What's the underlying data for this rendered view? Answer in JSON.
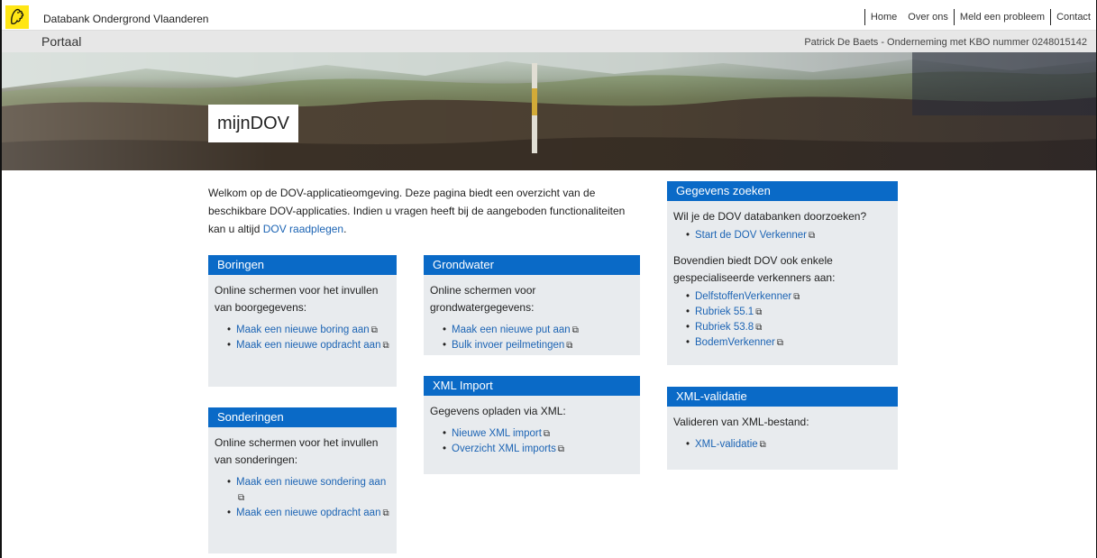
{
  "header": {
    "site_title": "Databank Ondergrond Vlaanderen",
    "nav": [
      "Home",
      "Over ons",
      "Meld een probleem",
      "Contact"
    ]
  },
  "subheader": {
    "portal": "Portaal",
    "user": "Patrick De Baets - Onderneming met KBO nummer 0248015142"
  },
  "banner": {
    "title": "mijnDOV"
  },
  "intro": {
    "text": "Welkom op de DOV-applicatieomgeving. Deze pagina biedt een overzicht van de beschikbare DOV-applicaties. Indien u vragen heeft bij de aangeboden functionaliteiten kan u altijd ",
    "link": "DOV raadplegen",
    "end": "."
  },
  "boringen": {
    "title": "Boringen",
    "text": "Online schermen voor het invullen van boorgegevens:",
    "links": [
      "Maak een nieuwe boring aan",
      "Maak een nieuwe opdracht aan"
    ]
  },
  "sonderingen": {
    "title": "Sonderingen",
    "text": "Online schermen voor het invullen van sonderingen:",
    "links": [
      "Maak een nieuwe sondering aan",
      "Maak een nieuwe opdracht aan"
    ]
  },
  "grondwater": {
    "title": "Grondwater",
    "text": "Online schermen voor grondwatergegevens:",
    "links": [
      "Maak een nieuwe put aan",
      "Bulk invoer peilmetingen"
    ]
  },
  "xml_import": {
    "title": "XML Import",
    "text": "Gegevens opladen via XML:",
    "links": [
      "Nieuwe XML import",
      "Overzicht XML imports"
    ]
  },
  "gegevens": {
    "title": "Gegevens zoeken",
    "text1": "Wil je de DOV databanken doorzoeken?",
    "links1": [
      "Start de DOV Verkenner"
    ],
    "text2": "Bovendien biedt DOV ook enkele gespecialiseerde verkenners aan:",
    "links2": [
      "DelfstoffenVerkenner",
      "Rubriek 55.1",
      "Rubriek 53.8",
      "BodemVerkenner"
    ]
  },
  "xml_validatie": {
    "title": "XML-validatie",
    "text": "Valideren van XML-bestand:",
    "links": [
      "XML-validatie"
    ]
  },
  "icons": {
    "logo": "flemish-lion-logo",
    "external": "external-link-icon",
    "ext_glyph": "⧉"
  },
  "colors": {
    "panel_header": "#0a6ac7",
    "panel_body": "#e8ebee",
    "link": "#1c64b4",
    "logo_yellow": "#ffe615"
  }
}
